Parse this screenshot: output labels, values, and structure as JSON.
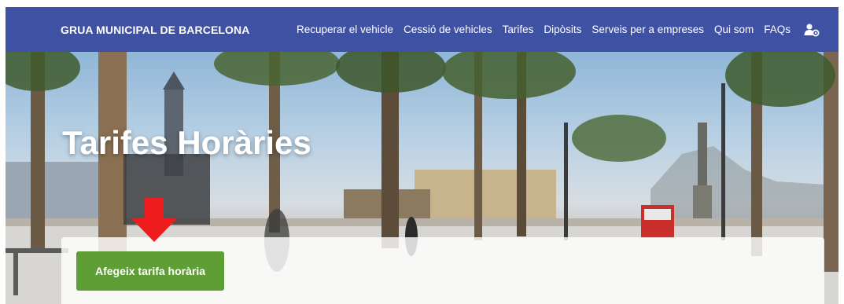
{
  "navbar": {
    "brand": "GRUA MUNICIPAL DE BARCELONA",
    "links": [
      "Recuperar el vehicle",
      "Cessió de vehicles",
      "Tarifes",
      "Dipòsits",
      "Serveis per a empreses",
      "Qui som",
      "FAQs"
    ],
    "user_icon": "user-settings-icon"
  },
  "hero": {
    "title": "Tarifes Horàries",
    "image": "barcelona-promenade-photo"
  },
  "actions": {
    "add_button_label": "Afegeix tarifa horària"
  },
  "annotation": {
    "arrow_icon": "down-arrow-icon",
    "arrow_color": "#ee1c1c"
  },
  "colors": {
    "navbar": "#3f51a3",
    "button": "#5e9e34"
  }
}
